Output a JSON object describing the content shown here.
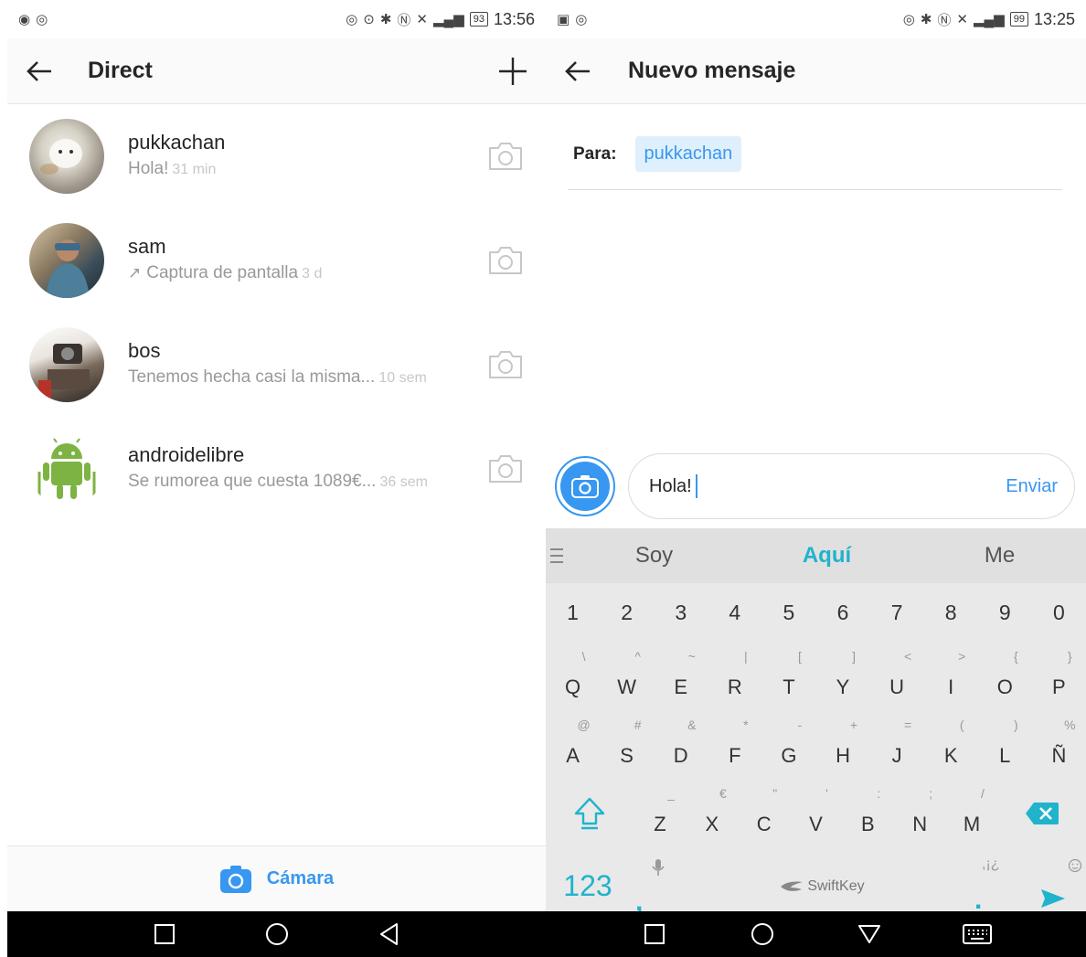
{
  "left": {
    "status_bar": {
      "battery": "93",
      "time": "13:56"
    },
    "header": {
      "title": "Direct"
    },
    "threads": [
      {
        "name": "pukkachan",
        "preview": "Hola!",
        "time": "31 min",
        "sent": false
      },
      {
        "name": "sam",
        "preview": "Captura de pantalla",
        "time": "3 d",
        "sent": true
      },
      {
        "name": "bos",
        "preview": "Tenemos hecha casi la misma...",
        "time": "10 sem",
        "sent": false
      },
      {
        "name": "androidelibre",
        "preview": "Se rumorea que cuesta 1089€...",
        "time": "36 sem",
        "sent": false
      }
    ],
    "camera_bar": {
      "label": "Cámara"
    }
  },
  "right": {
    "status_bar": {
      "battery": "99",
      "time": "13:25"
    },
    "header": {
      "title": "Nuevo mensaje"
    },
    "to": {
      "label": "Para:",
      "recipient": "pukkachan"
    },
    "composer": {
      "text": "Hola!",
      "send_label": "Enviar"
    },
    "keyboard": {
      "suggestions": [
        "Soy",
        "Aquí",
        "Me"
      ],
      "numbers": [
        "1",
        "2",
        "3",
        "4",
        "5",
        "6",
        "7",
        "8",
        "9",
        "0"
      ],
      "row_q": [
        {
          "k": "Q",
          "a": "\\"
        },
        {
          "k": "W",
          "a": "^"
        },
        {
          "k": "E",
          "a": "~"
        },
        {
          "k": "R",
          "a": "|"
        },
        {
          "k": "T",
          "a": "["
        },
        {
          "k": "Y",
          "a": "]"
        },
        {
          "k": "U",
          "a": "<"
        },
        {
          "k": "I",
          "a": ">"
        },
        {
          "k": "O",
          "a": "{"
        },
        {
          "k": "P",
          "a": "}"
        }
      ],
      "row_a": [
        {
          "k": "A",
          "a": "@"
        },
        {
          "k": "S",
          "a": "#"
        },
        {
          "k": "D",
          "a": "&"
        },
        {
          "k": "F",
          "a": "*"
        },
        {
          "k": "G",
          "a": "-"
        },
        {
          "k": "H",
          "a": "+"
        },
        {
          "k": "J",
          "a": "="
        },
        {
          "k": "K",
          "a": "("
        },
        {
          "k": "L",
          "a": ")"
        },
        {
          "k": "Ñ",
          "a": "%"
        }
      ],
      "row_z": [
        {
          "k": "Z",
          "a": "_"
        },
        {
          "k": "X",
          "a": "€"
        },
        {
          "k": "C",
          "a": "\""
        },
        {
          "k": "V",
          "a": "'"
        },
        {
          "k": "B",
          "a": ":"
        },
        {
          "k": "N",
          "a": ";"
        },
        {
          "k": "M",
          "a": "/"
        }
      ],
      "key_123": "123",
      "key_comma": ",",
      "space_label": "SwiftKey",
      "key_period": ".",
      "period_alt": ",¡¿"
    }
  },
  "colors": {
    "accent": "#3897f0",
    "swiftkey_accent": "#20b3cc"
  }
}
